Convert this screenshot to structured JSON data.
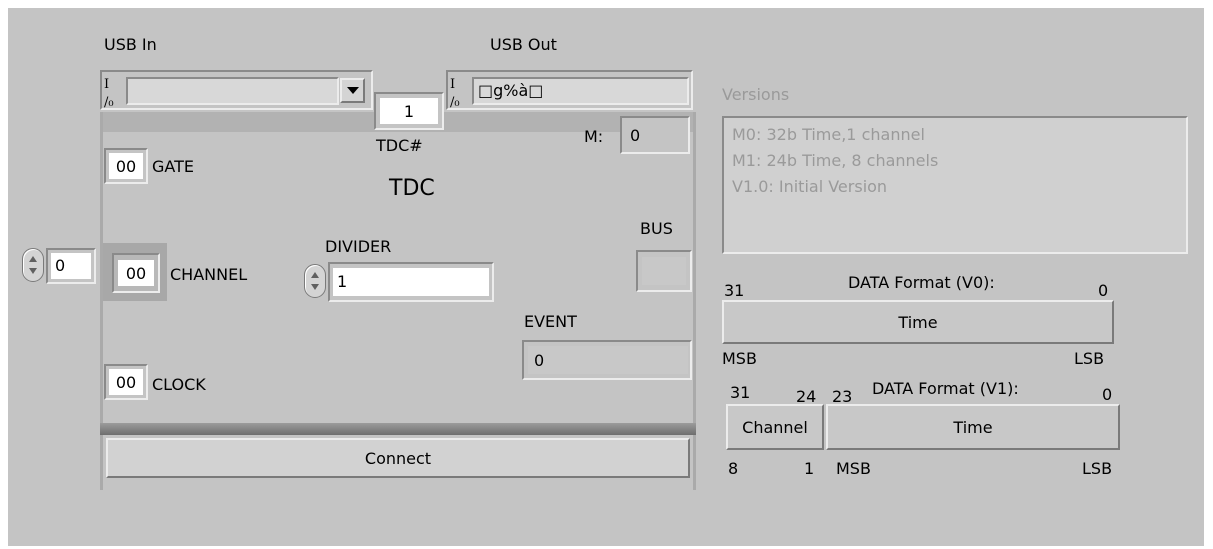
{
  "usb_in": {
    "label": "USB In",
    "io_glyph": "I/O",
    "value": ""
  },
  "usb_out": {
    "label": "USB Out",
    "io_glyph": "I/O",
    "value": "□g%à□"
  },
  "tdc_number": {
    "value": "1",
    "label": "TDC#"
  },
  "tdc_title": "TDC",
  "m_indicator": {
    "label": "M:",
    "value": "0"
  },
  "gate": {
    "value": "00",
    "label": "GATE"
  },
  "channel": {
    "value": "00",
    "label": "CHANNEL"
  },
  "clock": {
    "value": "00",
    "label": "CLOCK"
  },
  "left_numeric": {
    "value": "0"
  },
  "divider": {
    "label": "DIVIDER",
    "value": "1"
  },
  "bus": {
    "label": "BUS",
    "value": ""
  },
  "event": {
    "label": "EVENT",
    "value": "0"
  },
  "connect_button": {
    "label": "Connect"
  },
  "versions": {
    "label": "Versions",
    "lines": [
      "M0: 32b Time,1 channel",
      "M1: 24b Time, 8 channels",
      "V1.0: Initial Version"
    ]
  },
  "format_v0": {
    "title": "DATA Format (V0):",
    "bit_high": "31",
    "bit_low": "0",
    "field": "Time",
    "msb": "MSB",
    "lsb": "LSB"
  },
  "format_v1": {
    "title": "DATA Format (V1):",
    "channel_bit_high": "31",
    "channel_bit_low": "24",
    "time_bit_high": "23",
    "time_bit_low": "0",
    "channel_field": "Channel",
    "time_field": "Time",
    "channel_sub_high": "8",
    "channel_sub_low": "1",
    "msb": "MSB",
    "lsb": "LSB"
  }
}
